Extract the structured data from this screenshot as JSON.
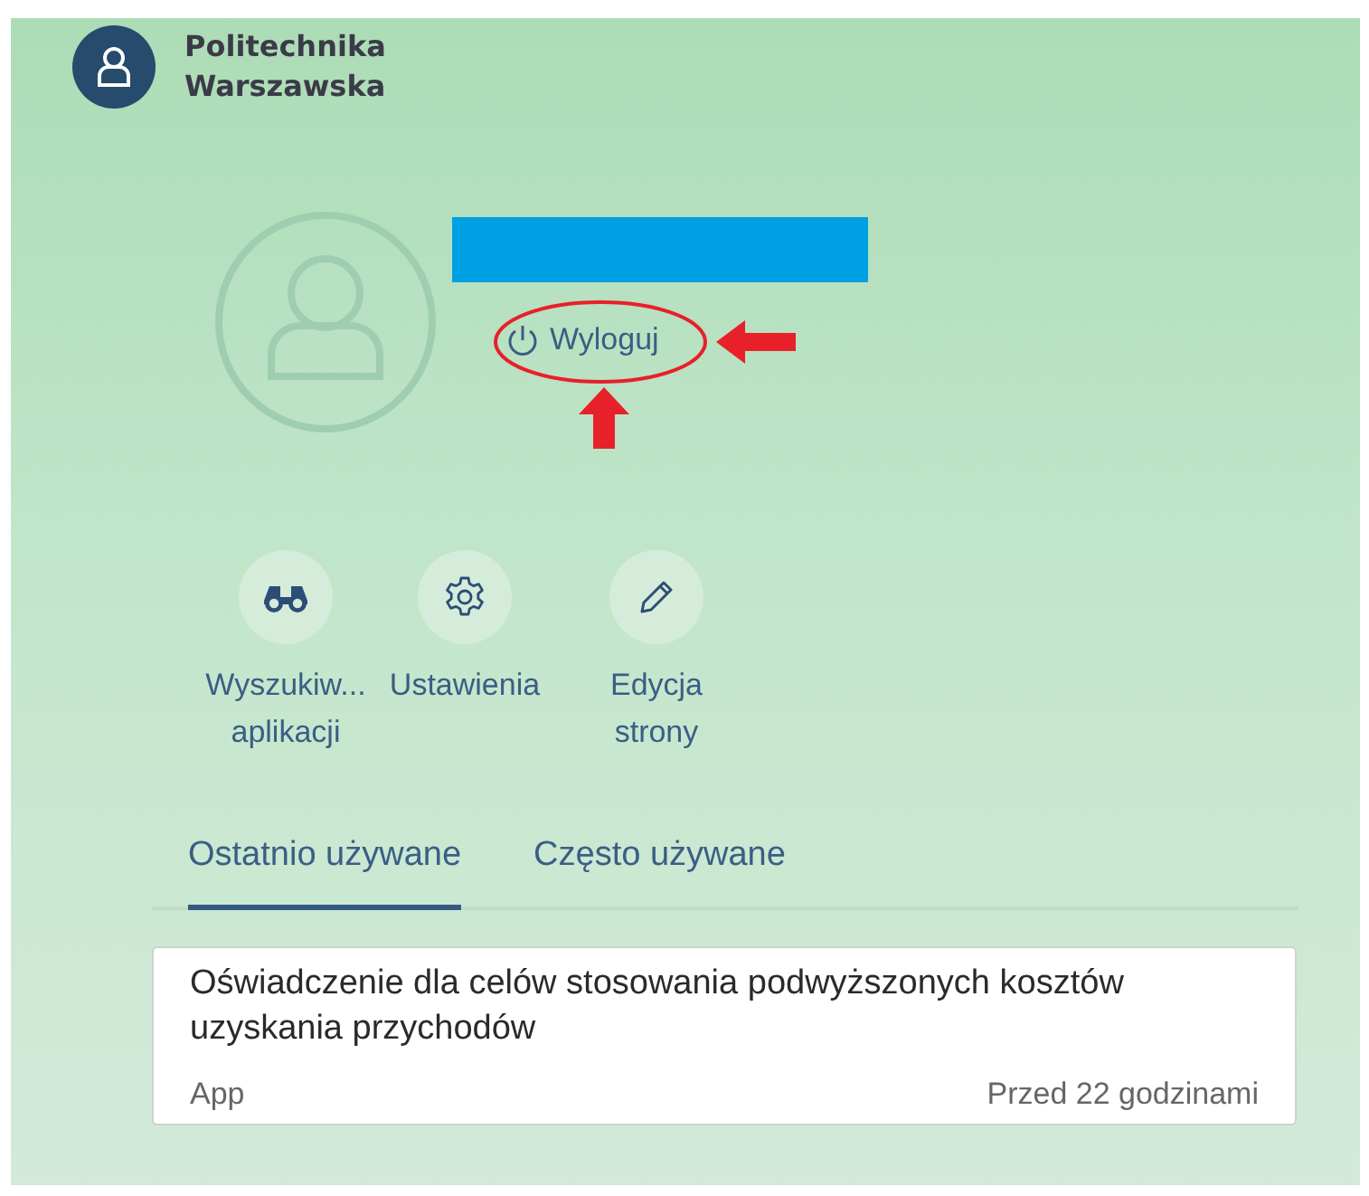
{
  "header": {
    "logo_lines": [
      "Politechnika",
      "Warszawska"
    ]
  },
  "profile": {
    "name_redacted": true,
    "logout": {
      "label": "Wyloguj",
      "annotated": true
    }
  },
  "actions": [
    {
      "label_lines": [
        "Wyszukiw...",
        "aplikacji"
      ]
    },
    {
      "label_lines": [
        "Ustawienia"
      ]
    },
    {
      "label_lines": [
        "Edycja",
        "strony"
      ]
    }
  ],
  "tabs": [
    {
      "label": "Ostatnio używane",
      "selected": true
    },
    {
      "label": "Często używane",
      "selected": false
    }
  ],
  "recent": [
    {
      "title": "Oświadczenie dla celów stosowania podwyższonych kosztów uzyskania przychodów",
      "type": "App",
      "time": "Przed 22 godzinami"
    }
  ]
}
